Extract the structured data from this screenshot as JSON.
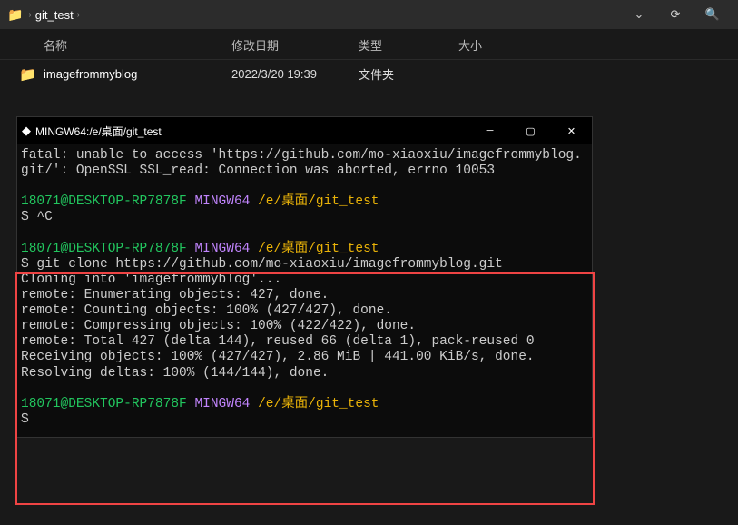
{
  "breadcrumb": {
    "segment": "git_test"
  },
  "columns": {
    "name": "名称",
    "date": "修改日期",
    "type": "类型",
    "size": "大小"
  },
  "files": [
    {
      "name": "imagefrommyblog",
      "date": "2022/3/20 19:39",
      "type": "文件夹",
      "size": ""
    }
  ],
  "terminal": {
    "title": "MINGW64:/e/桌面/git_test",
    "error_line1": "fatal: unable to access 'https://github.com/mo-xiaoxiu/imagefrommyblog.git/': OpenSSL SSL_read: Connection was aborted, errno 10053",
    "prompt_user": "18071@DESKTOP-RP7878F",
    "prompt_env": "MINGW64",
    "prompt_path": "/e/桌面/git_test",
    "cmd_interrupt": "$ ^C",
    "cmd_clone": "$ git clone https://github.com/mo-xiaoxiu/imagefrommyblog.git",
    "out_cloning": "Cloning into 'imagefrommyblog'...",
    "out_enum": "remote: Enumerating objects: 427, done.",
    "out_count": "remote: Counting objects: 100% (427/427), done.",
    "out_compress": "remote: Compressing objects: 100% (422/422), done.",
    "out_total": "remote: Total 427 (delta 144), reused 66 (delta 1), pack-reused 0",
    "out_recv": "Receiving objects: 100% (427/427), 2.86 MiB | 441.00 KiB/s, done.",
    "out_resolve": "Resolving deltas: 100% (144/144), done.",
    "final_prompt": "$"
  }
}
